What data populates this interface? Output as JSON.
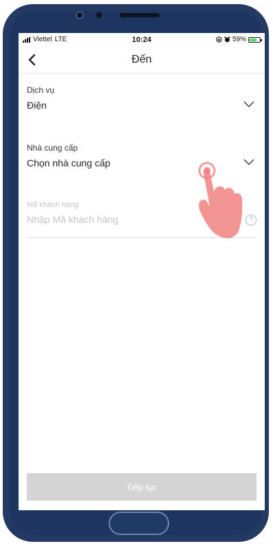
{
  "status_bar": {
    "carrier": "Viettel",
    "network": "LTE",
    "time": "10:24",
    "battery_percent": "59%",
    "battery_color": "#4cd964"
  },
  "header": {
    "title": "Đến",
    "back_icon": "chevron-left-icon"
  },
  "service": {
    "label": "Dịch vụ",
    "value": "Điện",
    "dropdown_icon": "chevron-down-icon"
  },
  "provider": {
    "label": "Nhà cung cấp",
    "value": "Chọn nhà cung cấp",
    "dropdown_icon": "chevron-down-icon"
  },
  "customer": {
    "label": "Mã khách hàng",
    "placeholder": "Nhập Mã khách hàng",
    "help_icon": "question-circle-icon",
    "help_glyph": "?"
  },
  "actions": {
    "continue_label": "Tiếp tục",
    "continue_color": "#d4d4d4"
  },
  "overlay": {
    "pointer_icon": "tap-hand-icon",
    "pointer_color": "#f07c7c"
  },
  "device": {
    "frame_color": "#243a62"
  }
}
